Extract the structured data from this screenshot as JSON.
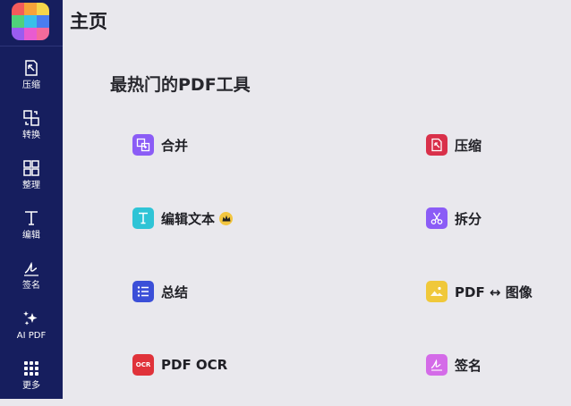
{
  "app": {
    "page_title": "主页",
    "section_title": "最热门的PDF工具",
    "brand_colors": [
      "#f45b5b",
      "#f7a23a",
      "#f6d54a",
      "#4fd27a",
      "#39c0e8",
      "#4a7df0",
      "#9a5cf0",
      "#e95bd0",
      "#f46a9b"
    ]
  },
  "sidebar": {
    "items": [
      {
        "label": "压缩",
        "icon": "compress-icon"
      },
      {
        "label": "转换",
        "icon": "convert-icon"
      },
      {
        "label": "整理",
        "icon": "organize-grid-icon"
      },
      {
        "label": "编辑",
        "icon": "text-edit-icon"
      },
      {
        "label": "签名",
        "icon": "signature-icon"
      },
      {
        "label": "AI PDF",
        "icon": "ai-sparkle-icon"
      },
      {
        "label": "更多",
        "icon": "more-dots-icon"
      }
    ]
  },
  "tools": [
    {
      "label": "合并",
      "icon": "merge-icon",
      "color": "#8b5cf6"
    },
    {
      "label": "压缩",
      "icon": "compress-icon",
      "color": "#d9304a"
    },
    {
      "label": "编辑文本",
      "icon": "text-edit-icon",
      "color": "#2fc4d6",
      "badge": "crown-icon"
    },
    {
      "label": "拆分",
      "icon": "scissors-icon",
      "color": "#8b5cf6"
    },
    {
      "label": "总结",
      "icon": "list-icon",
      "color": "#3b4fd8"
    },
    {
      "label": "PDF ↔ 图像",
      "icon": "image-icon",
      "color": "#f0c83a"
    },
    {
      "label": "PDF OCR",
      "icon": "ocr-icon",
      "color": "#e0323a",
      "icon_text": "OCR"
    },
    {
      "label": "签名",
      "icon": "signature-icon",
      "color": "#d46be8"
    }
  ]
}
